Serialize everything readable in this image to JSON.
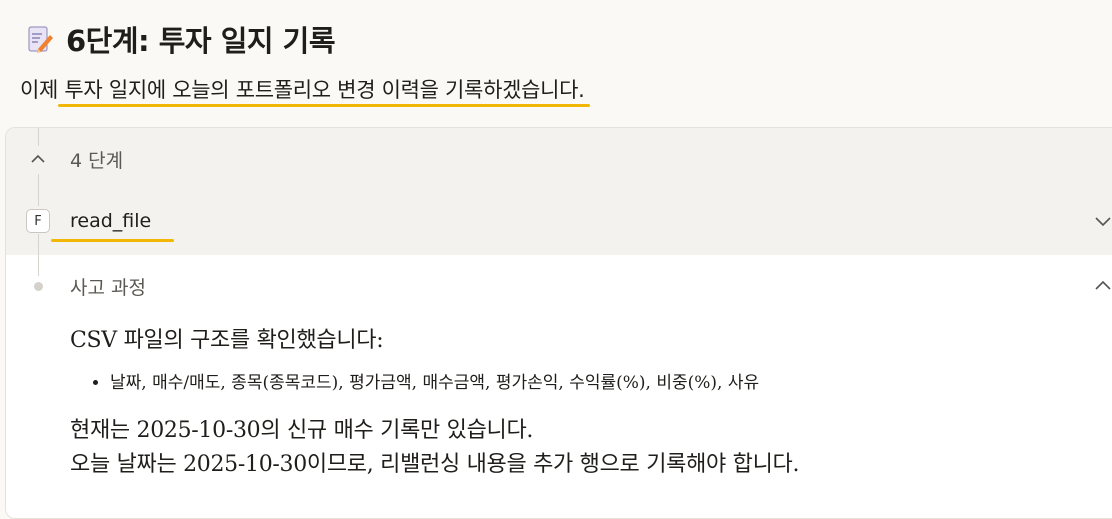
{
  "heading": {
    "icon": "memo-pencil-icon",
    "title": "6단계: 투자 일지 기록"
  },
  "intro": {
    "text": "이제 투자 일지에 오늘의 포트폴리오 변경 이력을 기록하겠습니다."
  },
  "panel": {
    "steps_label": "4 단계",
    "file_badge": "F",
    "file_label": "read_file",
    "thinking_label": "사고 과정",
    "content": {
      "line1": "CSV 파일의 구조를 확인했습니다:",
      "bullets": [
        "날짜, 매수/매도, 종목(종목코드), 평가금액, 매수금액, 평가손익, 수익률(%), 비중(%), 사유"
      ],
      "line2": "현재는 2025-10-30의 신규 매수 기록만 있습니다.",
      "line3": "오늘 날짜는 2025-10-30이므로, 리밸런싱 내용을 추가 행으로 기록해야 합니다."
    }
  },
  "colors": {
    "highlight": "#f2b705",
    "background": "#faf9f5",
    "panel_header_bg": "#f3f2ee"
  }
}
